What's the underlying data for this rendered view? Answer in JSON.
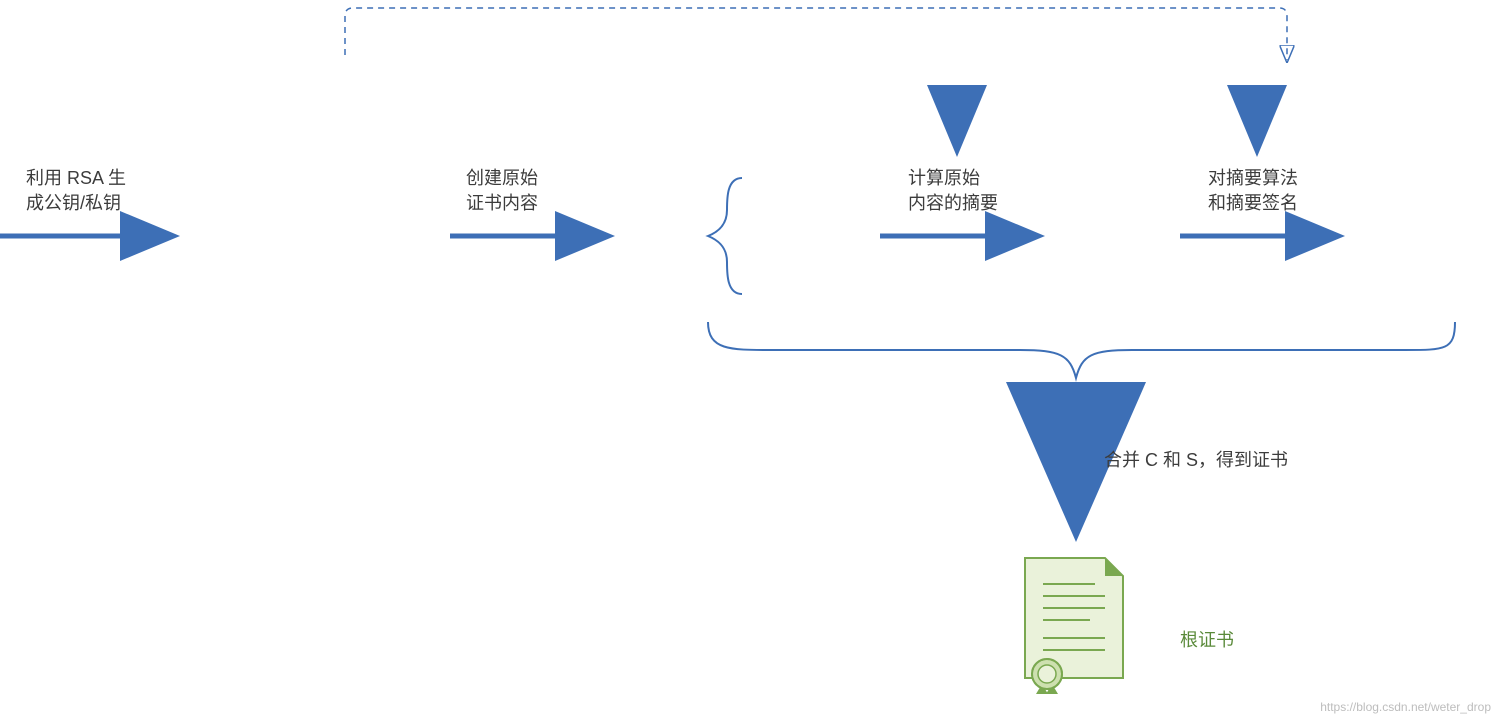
{
  "labels": {
    "step1": "利用 RSA 生\n成公钥/私钥",
    "step2": "创建原始\n证书内容",
    "step3": "计算原始\n内容的摘要",
    "step4": "对摘要算法\n和摘要签名",
    "merge": "合并 C 和 S，得到证书",
    "root_cert": "根证书"
  },
  "colors": {
    "arrow": "#3d6fb6",
    "text": "#3c3c3c",
    "green": "#5a8a3a",
    "cert_fill": "#eaf2da",
    "cert_accent": "#7aa850"
  },
  "watermark": "https://blog.csdn.net/weter_drop"
}
